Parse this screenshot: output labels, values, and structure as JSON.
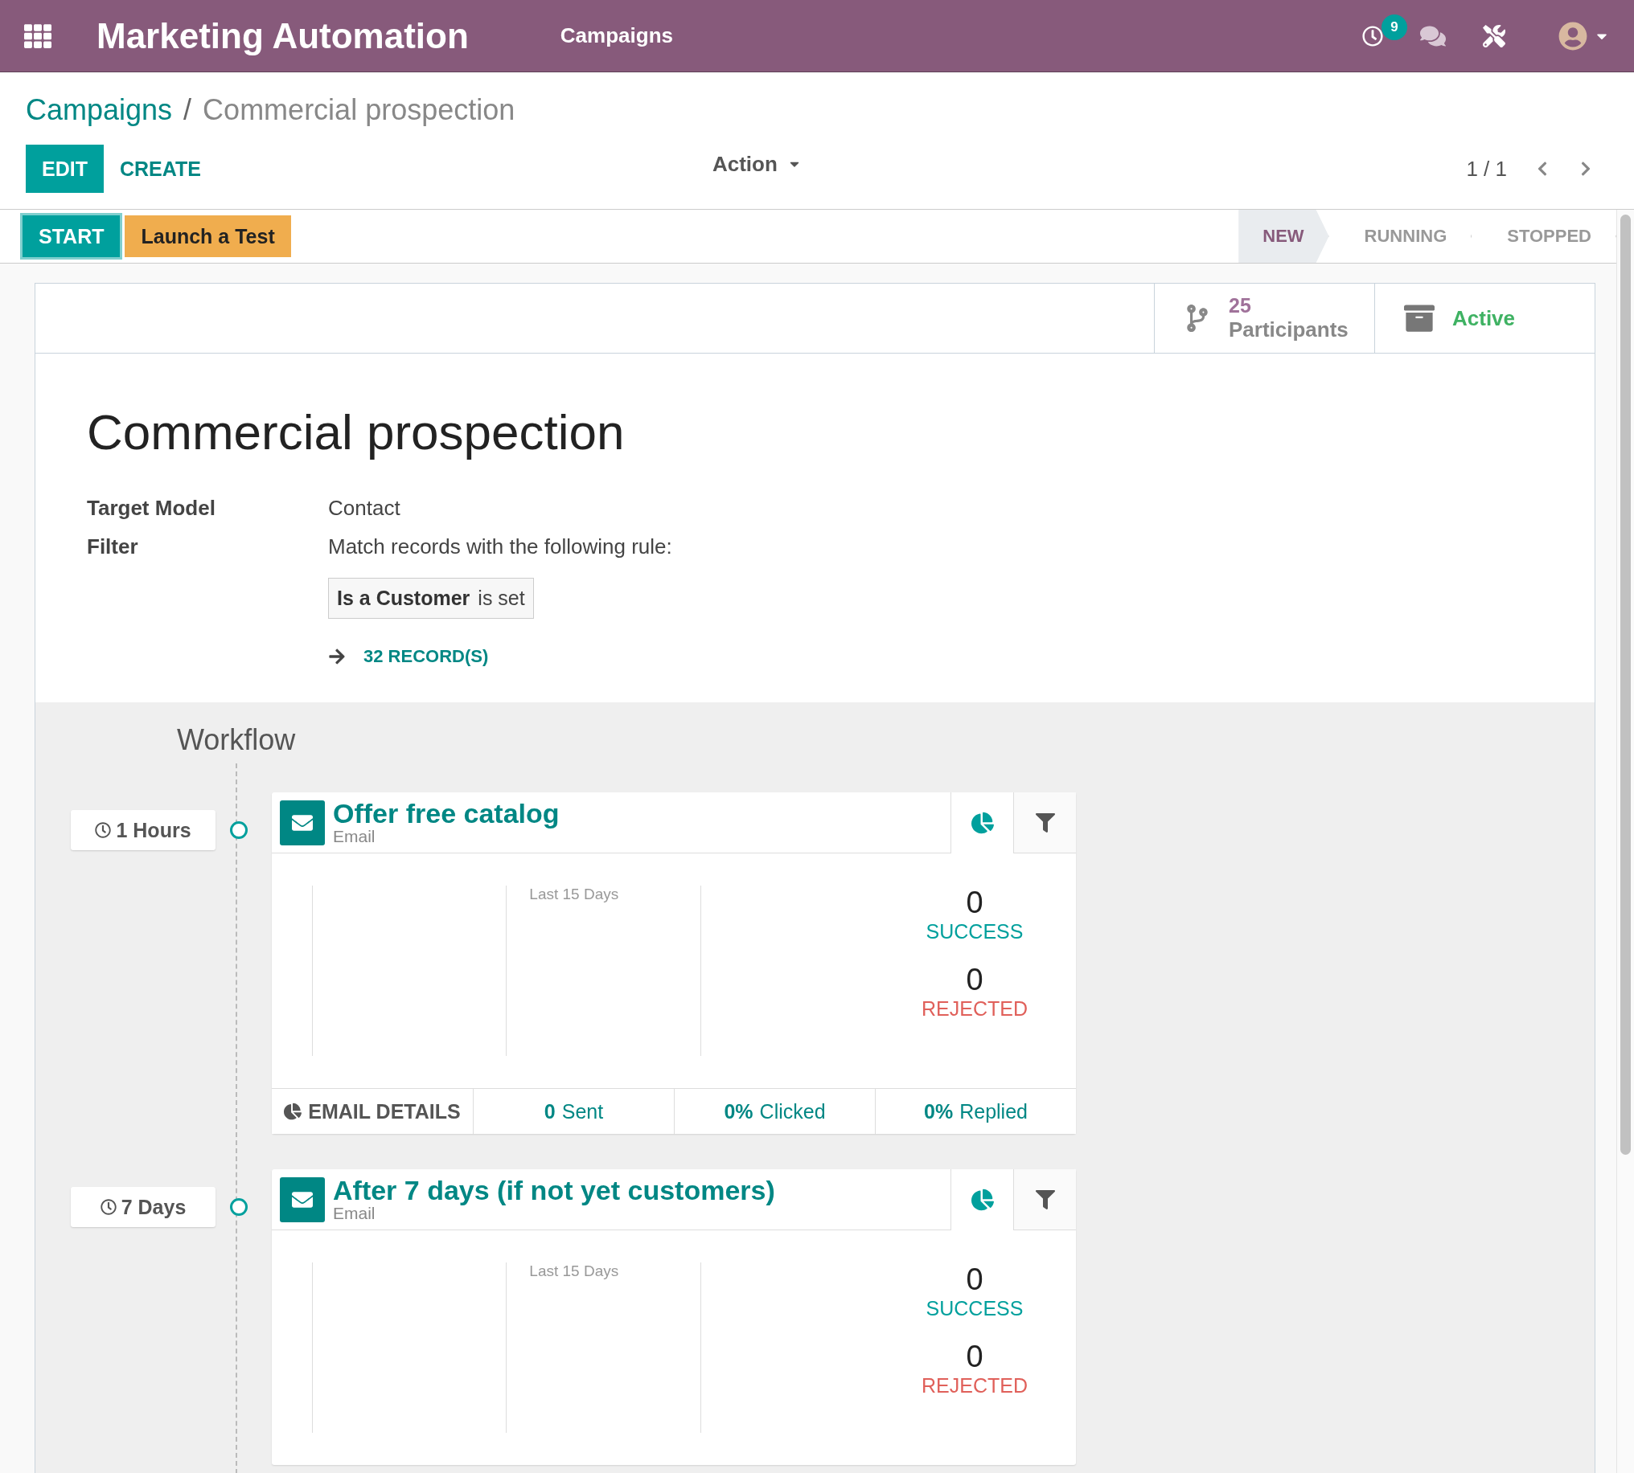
{
  "navbar": {
    "app_title": "Marketing Automation",
    "menu": [
      {
        "label": "Campaigns"
      }
    ],
    "activity_count": "9"
  },
  "breadcrumb_separator": "/",
  "breadcrumbs": [
    {
      "label": "Campaigns",
      "selected": false
    },
    {
      "label": "Commercial prospection",
      "selected": true
    }
  ],
  "control_buttons": [
    {
      "label": "EDIT",
      "kind": "primary"
    },
    {
      "label": "CREATE",
      "kind": "link"
    }
  ],
  "action_menu": "Action",
  "pager": "1 / 1",
  "header_buttons": [
    {
      "label": "START",
      "kind": "primary"
    },
    {
      "label": "Launch a Test",
      "kind": "warning"
    }
  ],
  "stages": [
    {
      "label": "NEW",
      "selected": true
    },
    {
      "label": "RUNNING",
      "selected": false
    },
    {
      "label": "STOPPED",
      "selected": false
    }
  ],
  "stat_buttons": [
    {
      "kind": "participants",
      "value": "25",
      "label": "Participants"
    },
    {
      "kind": "active",
      "label": "Active"
    }
  ],
  "title": "Commercial prospection",
  "fields": [
    {
      "label": "Target Model",
      "value": "Contact"
    },
    {
      "label": "Filter",
      "value": "Match records with the following rule:"
    }
  ],
  "domain": {
    "field": "Is a Customer",
    "operator": "is set"
  },
  "records_link": "32 RECORD(S)",
  "workflow": {
    "title": "Workflow",
    "activities": [
      {
        "trigger": "1 Hours",
        "name": "Offer free catalog",
        "type": "Email",
        "tabs": [
          {
            "kind": "graph",
            "selected": true
          },
          {
            "kind": "filter",
            "selected": false
          }
        ],
        "period": "Last 15 Days",
        "success": {
          "value": "0",
          "label": "SUCCESS"
        },
        "rejected": {
          "value": "0",
          "label": "REJECTED"
        },
        "details": {
          "label": "EMAIL DETAILS",
          "stats": [
            "**0** Sent",
            "**0%** Clicked",
            "**0%** Replied"
          ]
        }
      },
      {
        "trigger": "7 Days",
        "name": "After 7 days (if not yet customers)",
        "type": "Email",
        "tabs": [
          {
            "kind": "graph",
            "selected": true
          },
          {
            "kind": "filter",
            "selected": false
          }
        ],
        "period": "Last 15 Days",
        "success": {
          "value": "0",
          "label": "SUCCESS"
        },
        "rejected": {
          "value": "0",
          "label": "REJECTED"
        }
      }
    ]
  }
}
